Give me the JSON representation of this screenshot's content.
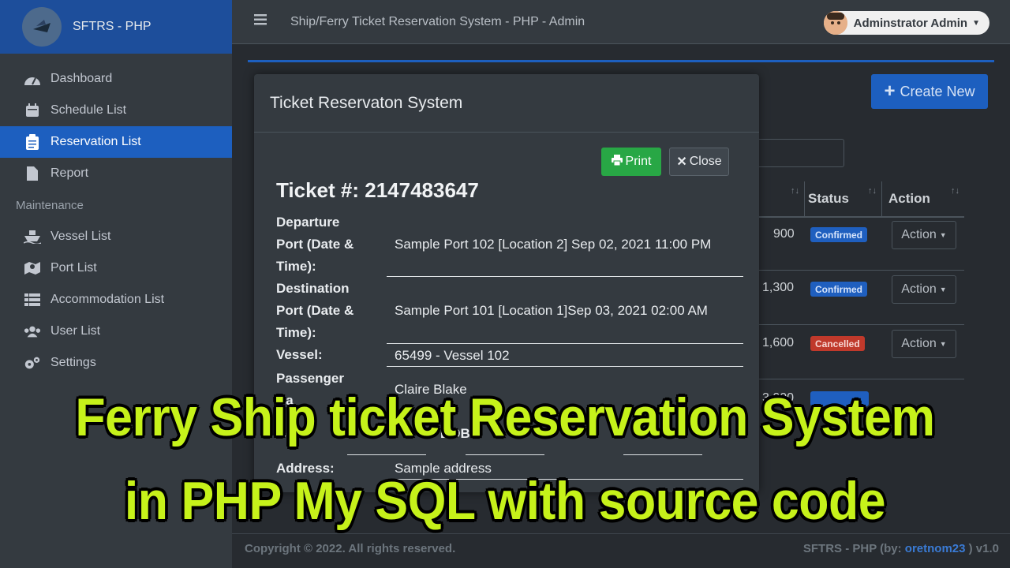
{
  "brand": {
    "name": "SFTRS - PHP"
  },
  "topbar": {
    "title": "Ship/Ferry Ticket Reservation System - PHP - Admin",
    "user": "Adminstrator Admin"
  },
  "sidebar": {
    "items": [
      {
        "label": "Dashboard",
        "icon": "dashboard-icon"
      },
      {
        "label": "Schedule List",
        "icon": "calendar-icon"
      },
      {
        "label": "Reservation List",
        "icon": "clipboard-icon",
        "active": true
      },
      {
        "label": "Report",
        "icon": "file-icon"
      }
    ],
    "maintenance_header": "Maintenance",
    "maintenance_items": [
      {
        "label": "Vessel List",
        "icon": "ship-icon"
      },
      {
        "label": "Port List",
        "icon": "map-icon"
      },
      {
        "label": "Accommodation List",
        "icon": "list-icon"
      },
      {
        "label": "User List",
        "icon": "users-icon"
      },
      {
        "label": "Settings",
        "icon": "gears-icon"
      }
    ]
  },
  "main": {
    "create_button": "Create New",
    "table": {
      "headers": [
        "Status",
        "Action"
      ],
      "rows": [
        {
          "amount": "900",
          "status": "Confirmed",
          "action": "Action"
        },
        {
          "amount": "1,300",
          "status": "Confirmed",
          "action": "Action"
        },
        {
          "amount": "1,600",
          "status": "Cancelled",
          "action": "Action"
        },
        {
          "amount": "3,000",
          "status": "",
          "action": ""
        }
      ]
    },
    "footer": {
      "left": "Copyright © 2022. All rights reserved.",
      "right_prefix": "SFTRS - PHP (by: ",
      "right_link": "oretnom23",
      "right_suffix": " ) v1.0"
    }
  },
  "modal": {
    "title": "Ticket Reservaton System",
    "print_label": "Print",
    "close_label": "Close",
    "ticket": "Ticket #: 2147483647",
    "departure_label_1": "Departure",
    "departure_label_2": "Port (Date &",
    "departure_label_3": "Time):",
    "departure_value": "Sample Port 102 [Location 2] Sep 02, 2021 11:00 PM",
    "destination_label_1": "Destination",
    "destination_label_2": "Port (Date &",
    "destination_label_3": "Time):",
    "destination_value": "Sample Port 101 [Location 1]Sep 03, 2021 02:00 AM",
    "vessel_label": "Vessel:",
    "vessel_value": "65499 - Vessel 102",
    "passenger_label_1": "Passenger",
    "passenger_label_2": "Na",
    "passenger_value": "Claire Blake",
    "gender_label": "Ge",
    "dob_label": "DOB",
    "address_label": "Address:",
    "address_value": "Sample address"
  },
  "caption": {
    "line1": "Ferry Ship ticket Reservation System",
    "line2": "in  PHP My SQL with source code"
  },
  "colors": {
    "caption": "#c6f21a",
    "accent": "#1d5fbf",
    "confirmed": "#1f5fbf",
    "cancelled": "#c0392b",
    "print": "#28a745"
  }
}
